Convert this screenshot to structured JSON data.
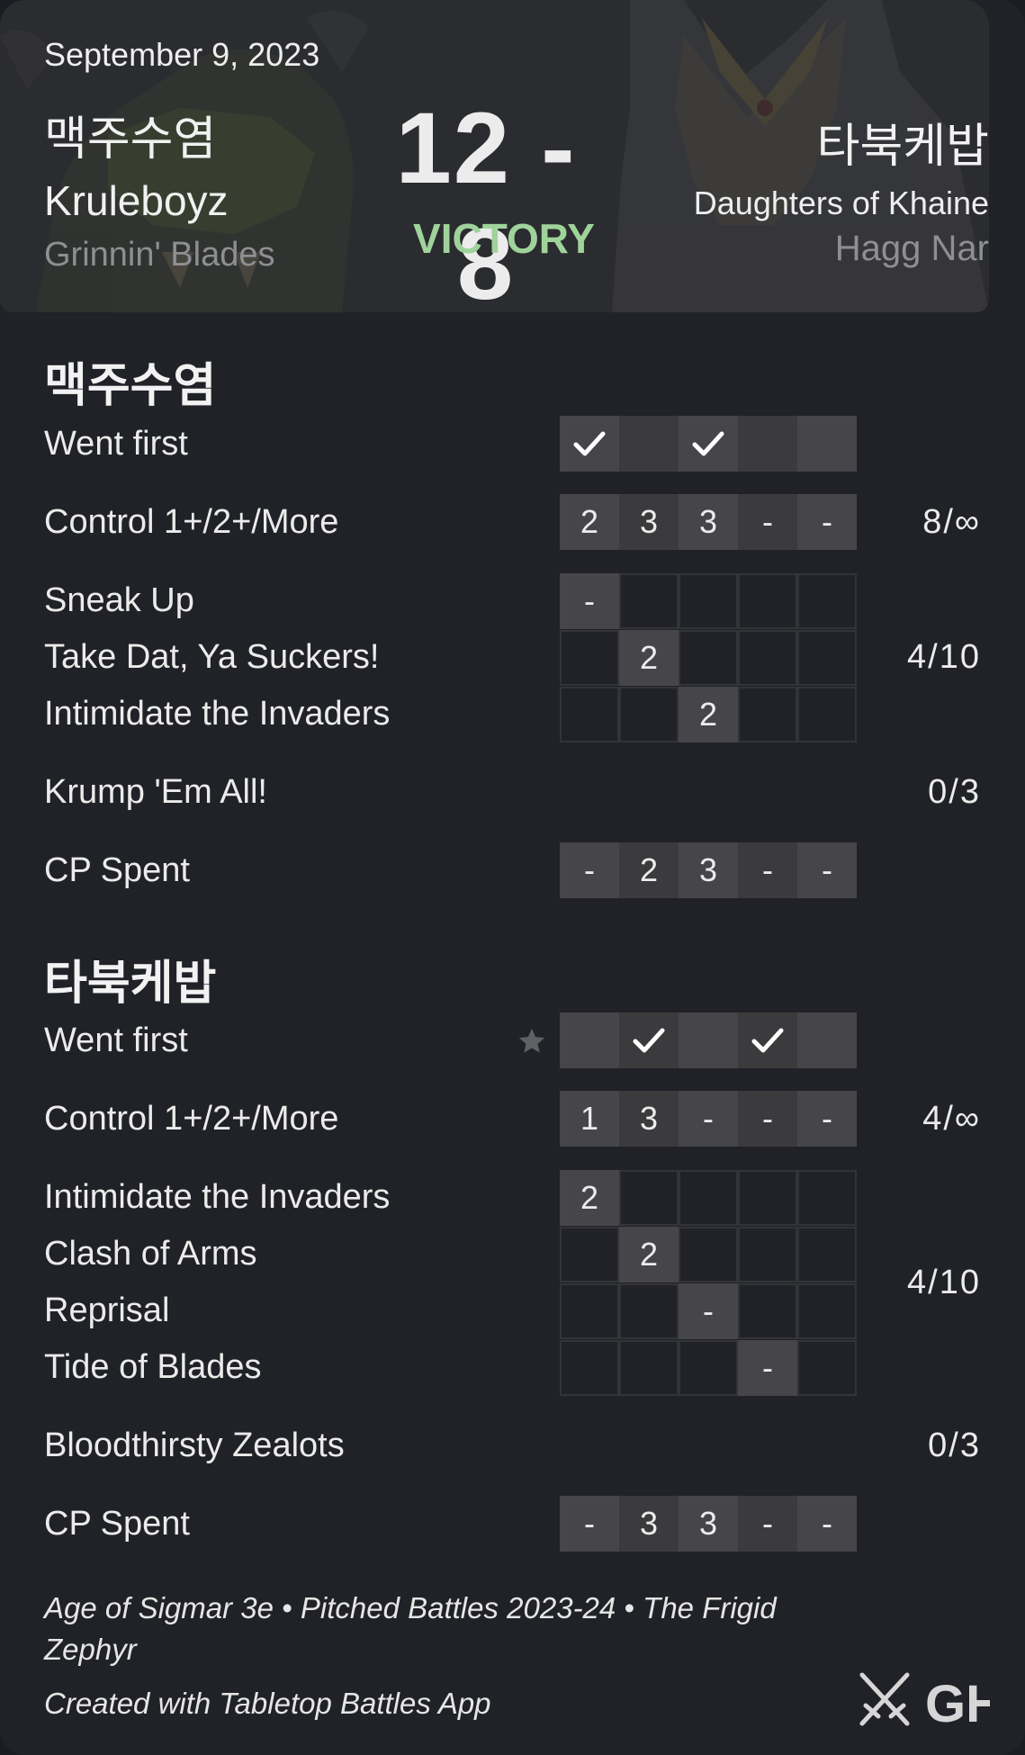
{
  "header": {
    "date": "September 9, 2023",
    "score": "12 - 8",
    "result": "VICTORY",
    "player1": {
      "name": "맥주수염",
      "faction": "Kruleboyz",
      "subfaction": "Grinnin' Blades"
    },
    "player2": {
      "name": "타북케밥",
      "faction": "Daughters of Khaine",
      "subfaction": "Hagg Nar"
    }
  },
  "player1": {
    "title": "맥주수염",
    "went_first": {
      "label": "Went first",
      "rounds": [
        true,
        false,
        true,
        false,
        false
      ]
    },
    "control": {
      "label": "Control 1+/2+/More",
      "values": [
        "2",
        "3",
        "3",
        "-",
        "-"
      ],
      "total": "8/∞"
    },
    "battle_tactics": {
      "total": "4/10",
      "items": [
        {
          "label": "Sneak Up",
          "round": 1,
          "value": "-"
        },
        {
          "label": "Take Dat, Ya Suckers!",
          "round": 2,
          "value": "2"
        },
        {
          "label": "Intimidate the Invaders",
          "round": 3,
          "value": "2"
        }
      ]
    },
    "grand_strategy": {
      "label": "Krump 'Em All!",
      "total": "0/3"
    },
    "cp_spent": {
      "label": "CP Spent",
      "values": [
        "-",
        "2",
        "3",
        "-",
        "-"
      ]
    }
  },
  "player2": {
    "title": "타북케밥",
    "went_first": {
      "label": "Went first",
      "starred": true,
      "rounds": [
        false,
        true,
        false,
        true,
        false
      ]
    },
    "control": {
      "label": "Control 1+/2+/More",
      "values": [
        "1",
        "3",
        "-",
        "-",
        "-"
      ],
      "total": "4/∞"
    },
    "battle_tactics": {
      "total": "4/10",
      "items": [
        {
          "label": "Intimidate the Invaders",
          "round": 1,
          "value": "2"
        },
        {
          "label": "Clash of Arms",
          "round": 2,
          "value": "2"
        },
        {
          "label": "Reprisal",
          "round": 3,
          "value": "-"
        },
        {
          "label": "Tide of Blades",
          "round": 4,
          "value": "-"
        }
      ]
    },
    "grand_strategy": {
      "label": "Bloodthirsty Zealots",
      "total": "0/3"
    },
    "cp_spent": {
      "label": "CP Spent",
      "values": [
        "-",
        "3",
        "3",
        "-",
        "-"
      ]
    }
  },
  "footer": {
    "info": "Age of Sigmar 3e • Pitched Battles 2023-24 • The Frigid Zephyr",
    "credit": "Created with Tabletop Battles App",
    "logo_text": "GH"
  },
  "icons": {
    "check": "check-icon",
    "star": "star-icon",
    "logo": "crossed-swords-icon"
  },
  "colors": {
    "background": "#202227",
    "header": "#2b2c2f",
    "victory": "#9fd39b",
    "cell": "#46464a"
  }
}
